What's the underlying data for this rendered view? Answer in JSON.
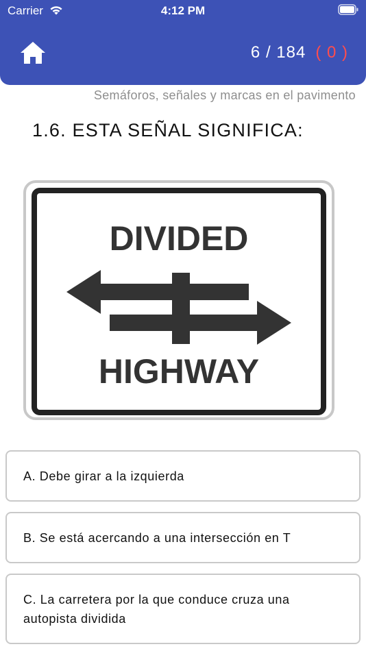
{
  "status_bar": {
    "carrier": "Carrier",
    "time": "4:12 PM"
  },
  "header": {
    "current": "6 / 184",
    "wrong": "( 0 )",
    "wrong_color": "#ff4d4d",
    "background_color": "#3d52b6"
  },
  "category": "Semáforos, señales y marcas en el pavimento",
  "question": "1.6. ESTA SEÑAL SIGNIFICA:",
  "sign": {
    "top_text": "DIVIDED",
    "bottom_text": "HIGHWAY"
  },
  "options": [
    {
      "label": "A. Debe girar a la izquierda"
    },
    {
      "label": "B. Se está acercando a una intersección en T"
    },
    {
      "label": "C. La carretera por la que conduce cruza una autopista dividida"
    }
  ]
}
